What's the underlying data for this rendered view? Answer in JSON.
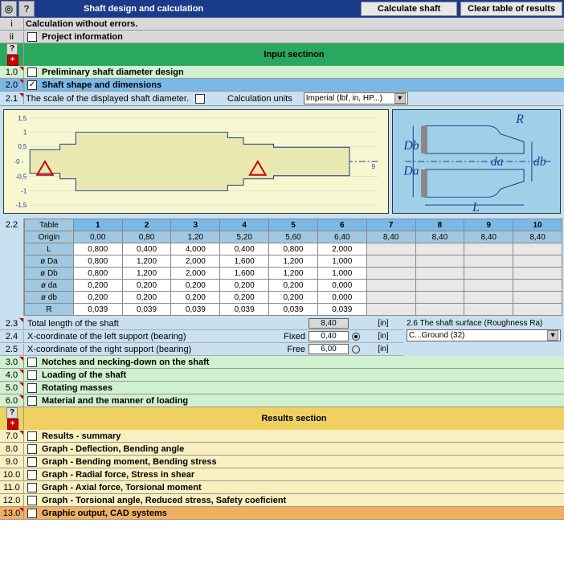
{
  "header": {
    "title": "Shaft design and calculation",
    "btn_calc": "Calculate shaft",
    "btn_clear": "Clear table of results"
  },
  "info": {
    "i_label": "i",
    "i_text": "Calculation without errors.",
    "ii_label": "ii",
    "ii_text": "Project information"
  },
  "input_section": {
    "title": "Input sectinon",
    "r1_num": "1.0",
    "r1_text": "Preliminary shaft diameter design",
    "r2_num": "2.0",
    "r2_text": "Shaft shape and dimensions",
    "r21_num": "2.1",
    "r21_text": "The scale of the displayed shaft diameter.",
    "r21_units": "Calculation units",
    "units_dropdown": "Imperial (lbf, in, HP...)"
  },
  "chart_data": {
    "type": "line",
    "title": "",
    "xlabel": "",
    "ylabel": "",
    "xlim": [
      0,
      9
    ],
    "ylim": [
      -1.5,
      1.5
    ],
    "xticks": [
      0,
      1,
      2,
      3,
      4,
      5,
      6,
      7,
      8,
      9
    ],
    "yticks": [
      -1.5,
      -1,
      -0.5,
      0,
      0.5,
      1,
      1.5
    ],
    "series": [
      {
        "name": "shaft_outline_top",
        "x": [
          0.0,
          0.8,
          0.8,
          1.2,
          1.2,
          5.2,
          5.2,
          5.6,
          5.6,
          6.4,
          6.4,
          8.4
        ],
        "y": [
          0.4,
          0.4,
          0.6,
          0.6,
          1.0,
          1.0,
          0.8,
          0.8,
          0.6,
          0.6,
          0.5,
          0.5
        ]
      },
      {
        "name": "shaft_outline_bot",
        "x": [
          0.0,
          0.8,
          0.8,
          1.2,
          1.2,
          5.2,
          5.2,
          5.6,
          5.6,
          6.4,
          6.4,
          8.4
        ],
        "y": [
          -0.4,
          -0.4,
          -0.6,
          -0.6,
          -1.0,
          -1.0,
          -0.8,
          -0.8,
          -0.6,
          -0.6,
          -0.5,
          -0.5
        ]
      }
    ],
    "supports": [
      {
        "x": 0.4,
        "type": "fixed"
      },
      {
        "x": 6.0,
        "type": "free"
      }
    ]
  },
  "diagram_labels": {
    "R": "R",
    "Db": "Db",
    "Da": "Da",
    "da": "da",
    "db": "db",
    "L": "L"
  },
  "table": {
    "num": "2.2",
    "hdr_table": "Table",
    "hdr_origin": "Origin",
    "cols": [
      "1",
      "2",
      "3",
      "4",
      "5",
      "6",
      "7",
      "8",
      "9",
      "10"
    ],
    "origin": [
      "0,00",
      "0,80",
      "1,20",
      "5,20",
      "5,60",
      "6,40",
      "8,40",
      "8,40",
      "8,40",
      "8,40"
    ],
    "rows": [
      {
        "name": "L",
        "vals": [
          "0,800",
          "0,400",
          "4,000",
          "0,400",
          "0,800",
          "2,000",
          "",
          "",
          "",
          ""
        ]
      },
      {
        "name": "ø Da",
        "vals": [
          "0,800",
          "1,200",
          "2,000",
          "1,600",
          "1,200",
          "1,000",
          "",
          "",
          "",
          ""
        ]
      },
      {
        "name": "ø Db",
        "vals": [
          "0,800",
          "1,200",
          "2,000",
          "1,600",
          "1,200",
          "1,000",
          "",
          "",
          "",
          ""
        ]
      },
      {
        "name": "ø da",
        "vals": [
          "0,200",
          "0,200",
          "0,200",
          "0,200",
          "0,200",
          "0,000",
          "",
          "",
          "",
          ""
        ]
      },
      {
        "name": "ø db",
        "vals": [
          "0,200",
          "0,200",
          "0,200",
          "0,200",
          "0,200",
          "0,000",
          "",
          "",
          "",
          ""
        ]
      },
      {
        "name": "R",
        "vals": [
          "0,039",
          "0,039",
          "0,039",
          "0,039",
          "0,039",
          "0,039",
          "",
          "",
          "",
          ""
        ]
      }
    ]
  },
  "params": {
    "r23_num": "2.3",
    "r23_text": "Total length of the shaft",
    "r23_val": "8,40",
    "r23_unit": "[in]",
    "r24_num": "2.4",
    "r24_text": "X-coordinate of the left support (bearing)",
    "r24_mode": "Fixed",
    "r24_val": "0,40",
    "r24_unit": "[in]",
    "r25_num": "2.5",
    "r25_text": "X-coordinate of the right support (bearing)",
    "r25_mode": "Free",
    "r25_val": "6,00",
    "r25_unit": "[in]",
    "r26_num": "2.6",
    "r26_text": "The shaft surface (Roughness Ra)",
    "r26_val": "C...Ground  (32)"
  },
  "green_rows": {
    "r3_num": "3.0",
    "r3_text": "Notches and necking-down on the shaft",
    "r4_num": "4.0",
    "r4_text": "Loading of the shaft",
    "r5_num": "5.0",
    "r5_text": "Rotating masses",
    "r6_num": "6.0",
    "r6_text": "Material and the manner of loading"
  },
  "results_section": {
    "title": "Results section",
    "r7_num": "7.0",
    "r7_text": "Results - summary",
    "r8_num": "8.0",
    "r8_text": "Graph - Deflection, Bending angle",
    "r9_num": "9.0",
    "r9_text": "Graph - Bending moment, Bending stress",
    "r10_num": "10.0",
    "r10_text": "Graph - Radial force, Stress in shear",
    "r11_num": "11.0",
    "r11_text": "Graph - Axial force,   Torsional moment",
    "r12_num": "12.0",
    "r12_text": "Graph - Torsional angle,   Reduced stress,   Safety coeficient",
    "r13_num": "13.0",
    "r13_text": "Graphic output, CAD systems"
  }
}
